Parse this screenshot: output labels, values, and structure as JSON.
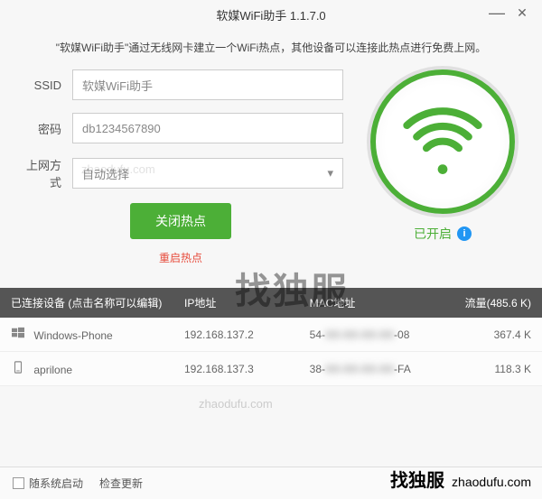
{
  "titlebar": {
    "title": "软媒WiFi助手 1.1.7.0"
  },
  "description": "\"软媒WiFi助手\"通过无线网卡建立一个WiFi热点，其他设备可以连接此热点进行免费上网。",
  "form": {
    "ssid_label": "SSID",
    "ssid_value": "软媒WiFi助手",
    "password_label": "密码",
    "password_value": "db1234567890",
    "method_label": "上网方式",
    "method_value": "自动选择",
    "close_hotspot_btn": "关闭热点",
    "restart_link": "重启热点"
  },
  "status": {
    "text": "已开启",
    "info_symbol": "i"
  },
  "table": {
    "header": {
      "device": "已连接设备 (点击名称可以编辑)",
      "ip": "IP地址",
      "mac": "MAC地址",
      "traffic": "流量(485.6 K)"
    },
    "rows": [
      {
        "device": "Windows-Phone",
        "ip": "192.168.137.2",
        "mac_prefix": "54-",
        "mac_hidden": "XX-XX-XX-XX",
        "mac_suffix": "-08",
        "traffic": "367.4 K",
        "icon": "windows"
      },
      {
        "device": "aprilone",
        "ip": "192.168.137.3",
        "mac_prefix": "38-",
        "mac_hidden": "XX-XX-XX-XX",
        "mac_suffix": "-FA",
        "traffic": "118.3 K",
        "icon": "phone"
      }
    ]
  },
  "footer": {
    "autostart": "随系统启动",
    "check_update": "检查更新"
  },
  "watermarks": {
    "big": "找独服",
    "small": "zhaodufu.com",
    "logo_text": "找独服",
    "logo_url": "zhaodufu.com"
  }
}
